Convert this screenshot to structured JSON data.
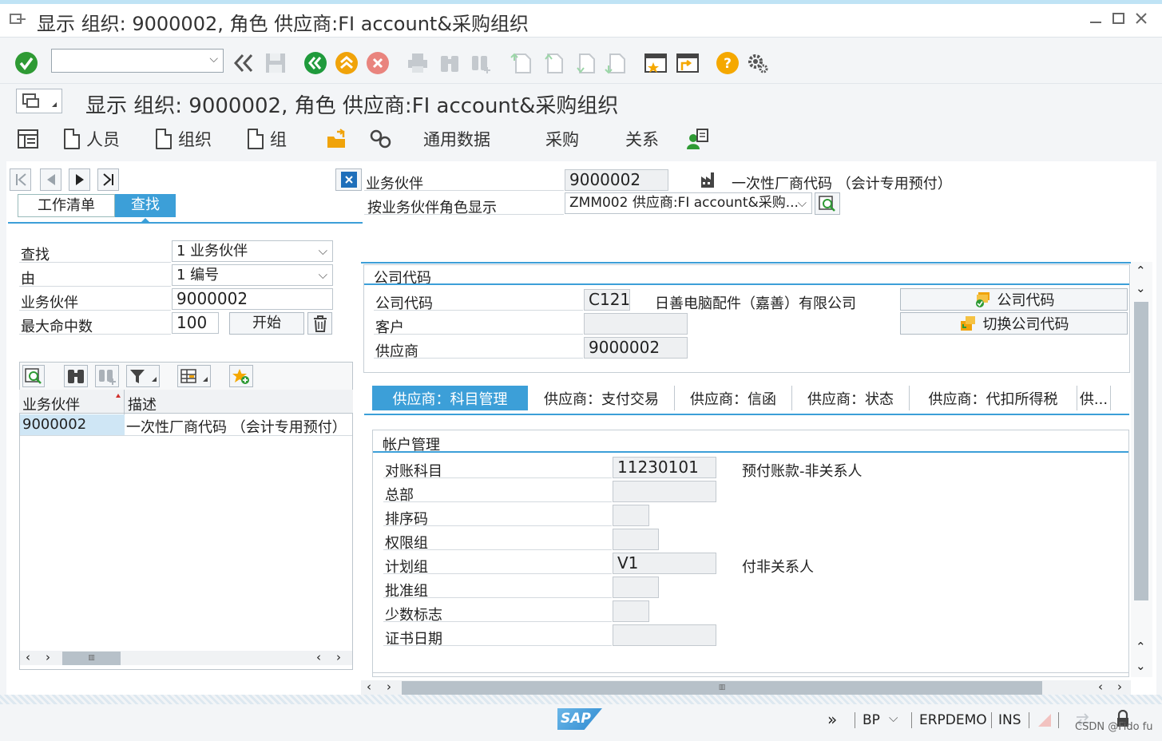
{
  "window": {
    "title": "显示 组织: 9000002, 角色 供应商:FI account&采购组织"
  },
  "toolbar": {
    "icons": [
      "check-icon",
      "save-icon",
      "back-icon",
      "exit-icon",
      "cancel-icon",
      "print-icon",
      "find-icon",
      "find-next-icon",
      "first-page-icon",
      "prev-page-icon",
      "next-page-icon",
      "last-page-icon",
      "new-session-icon",
      "shortcut-icon",
      "help-icon",
      "settings-icon"
    ]
  },
  "subtitle": "显示 组织: 9000002, 角色 供应商:FI account&采购组织",
  "appbar": {
    "person": "人员",
    "organization": "组织",
    "group": "组",
    "general_data": "通用数据",
    "purchasing": "采购",
    "relationships": "关系"
  },
  "locator": {
    "tab_worklist": "工作清单",
    "tab_find": "查找",
    "find_label": "查找",
    "find_value": "1 业务伙伴",
    "by_label": "由",
    "by_value": "1 编号",
    "bp_label": "业务伙伴",
    "bp_value": "9000002",
    "max_hits_label": "最大命中数",
    "max_hits_value": "100",
    "start_button": "开始",
    "grid_col_bp": "业务伙伴",
    "grid_col_desc": "描述",
    "grid_rows": [
      {
        "bp": "9000002",
        "desc": "一次性厂商代码 （会计专用预付）"
      }
    ],
    "scroll_mark": "▥"
  },
  "header": {
    "bp_label": "业务伙伴",
    "bp_value": "9000002",
    "bp_desc": "一次性厂商代码 （会计专用预付）",
    "role_label": "按业务伙伴角色显示",
    "role_value": "ZMM002 供应商:FI account&采购..."
  },
  "company": {
    "section_title": "公司代码",
    "code_label": "公司代码",
    "code_value": "C121",
    "code_name": "日善电脑配件（嘉善）有限公司",
    "customer_label": "客户",
    "customer_value": "",
    "vendor_label": "供应商",
    "vendor_value": "9000002",
    "btn_company_code": "公司代码",
    "btn_switch": "切换公司代码"
  },
  "vendor_tabs": [
    "供应商：科目管理",
    "供应商：支付交易",
    "供应商：信函",
    "供应商：状态",
    "供应商：代扣所得税",
    "供..."
  ],
  "account": {
    "section_title": "帐户管理",
    "rows": [
      {
        "label": "对账科目",
        "value": "11230101",
        "desc": "预付账款-非关系人"
      },
      {
        "label": "总部",
        "value": "",
        "desc": ""
      },
      {
        "label": "排序码",
        "value": "",
        "desc": ""
      },
      {
        "label": "权限组",
        "value": "",
        "desc": ""
      },
      {
        "label": "计划组",
        "value": "V1",
        "desc": "付非关系人"
      },
      {
        "label": "批准组",
        "value": "",
        "desc": ""
      },
      {
        "label": "少数标志",
        "value": "",
        "desc": ""
      },
      {
        "label": "证书日期",
        "value": "",
        "desc": ""
      }
    ]
  },
  "status": {
    "logo": "SAP",
    "transaction": "BP",
    "system": "ERPDEMO",
    "mode": "INS",
    "watermark": "CSDN @Fido fu"
  },
  "colors": {
    "accent": "#3c9fd8",
    "ok_green": "#2e9a34",
    "nav_green": "#1f9a3c",
    "exit_orange": "#f0a30a",
    "cancel_red": "#e0534a",
    "help_orange": "#f5a800"
  }
}
